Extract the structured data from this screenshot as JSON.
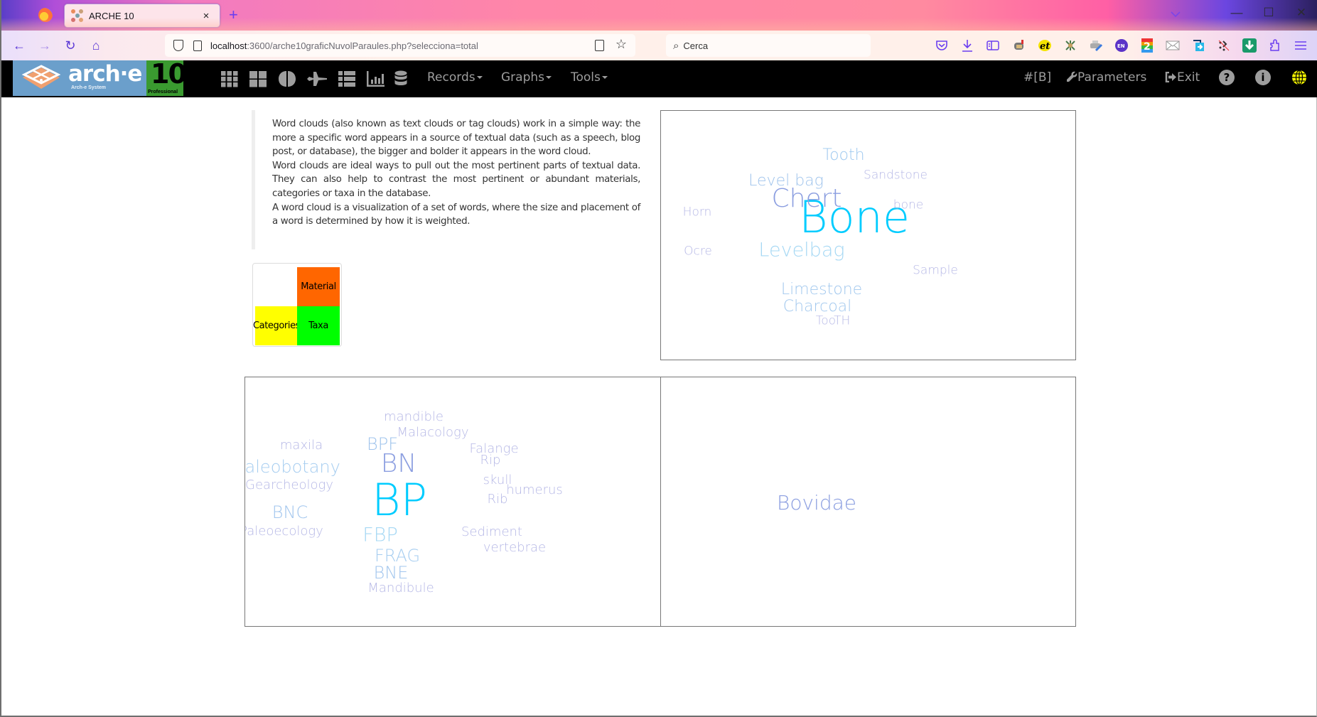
{
  "browser": {
    "tab_title": "ARCHE 10",
    "tab_close": "×",
    "new_tab": "+",
    "url_host": "localhost",
    "url_rest": ":3600/arche10graficNuvolParaules.php?selecciona=total",
    "search_placeholder": "Cerca",
    "list_tabs_icon": "chevron-down-icon",
    "window_controls": {
      "minimize": "—",
      "maximize": "☐",
      "close": "✕"
    },
    "nav": {
      "back": "←",
      "forward": "→",
      "reload": "↻",
      "home": "⌂"
    },
    "extensions": [
      "pocket-icon",
      "download-icon",
      "sidebar-icon",
      "mailbox-icon",
      "et-icon",
      "figure-icon",
      "printer-icon",
      "en-translate-icon",
      "two-icon",
      "mail-icon",
      "share-icon",
      "cursor-off-icon",
      "green-download-icon",
      "extensions-puzzle-icon",
      "hamburger-menu-icon"
    ]
  },
  "app": {
    "logo": {
      "name": "arch·e",
      "subtitle": "Arch-e System",
      "version": "10",
      "edition": "Professional"
    },
    "toolbar_icons": [
      "grid-9-icon",
      "grid-4-icon",
      "brain-icon",
      "plane-icon",
      "list-icon",
      "bar-chart-icon",
      "database-icon"
    ],
    "menus": [
      {
        "label": "Records"
      },
      {
        "label": "Graphs"
      },
      {
        "label": "Tools"
      }
    ],
    "right": {
      "hash_label": "#[B]",
      "parameters_label": "Parameters",
      "exit_label": "Exit",
      "help_glyph": "?",
      "info_glyph": "i"
    }
  },
  "intro": {
    "paragraphs": [
      "Word clouds (also known as text clouds or tag clouds) work in a simple way: the more a specific word appears in a source of textual data (such as a speech, blog post, or database), the bigger and bolder it appears in the word cloud.",
      "Word clouds are ideal ways to pull out the most pertinent parts of textual data. They can also help to contrast the most pertinent or abundant materials, categories or taxa in the database.",
      "A word cloud is a visualization of a set of words, where the size and placement of a word is determined by how it is weighted."
    ]
  },
  "legend": {
    "material": {
      "label": "Material",
      "color": "#ff6600"
    },
    "categories": {
      "label": "Categories",
      "color": "#ffff00"
    },
    "taxa": {
      "label": "Taxa",
      "color": "#00ff00"
    }
  },
  "clouds": {
    "material": [
      {
        "text": "Bone",
        "weight": 100,
        "color": "#00ccff"
      },
      {
        "text": "Chert",
        "weight": 50,
        "color": "#8b9ee0"
      },
      {
        "text": "Levelbag",
        "weight": 33,
        "color": "#a6d8f4"
      },
      {
        "text": "Level bag",
        "weight": 24,
        "color": "#a0c4ec"
      },
      {
        "text": "Tooth",
        "weight": 24,
        "color": "#9ec8ef"
      },
      {
        "text": "Limestone",
        "weight": 24,
        "color": "#a2c8ee"
      },
      {
        "text": "Charcoal",
        "weight": 24,
        "color": "#a2c8ee"
      },
      {
        "text": "Sandstone",
        "weight": 14,
        "color": "#b6b8e6"
      },
      {
        "text": "bone",
        "weight": 14,
        "color": "#b6b8e6"
      },
      {
        "text": "Horn",
        "weight": 14,
        "color": "#b6b8e6"
      },
      {
        "text": "Ocre",
        "weight": 14,
        "color": "#b6b8e6"
      },
      {
        "text": "Sample",
        "weight": 14,
        "color": "#b6b8e6"
      },
      {
        "text": "TooTH",
        "weight": 13,
        "color": "#b6b8e6"
      }
    ],
    "categories": [
      {
        "text": "BP",
        "weight": 100,
        "color": "#00ccff"
      },
      {
        "text": "BN",
        "weight": 50,
        "color": "#8b9ee0"
      },
      {
        "text": "FBP",
        "weight": 33,
        "color": "#a6d8f4"
      },
      {
        "text": "BPF",
        "weight": 26,
        "color": "#a0c4ec"
      },
      {
        "text": "Paleobotany",
        "weight": 26,
        "color": "#a6cdf0"
      },
      {
        "text": "BNC",
        "weight": 26,
        "color": "#a2c6ee"
      },
      {
        "text": "FRAG",
        "weight": 26,
        "color": "#a6cdf0"
      },
      {
        "text": "BNE",
        "weight": 26,
        "color": "#a2c6ee"
      },
      {
        "text": "mandible",
        "weight": 15,
        "color": "#b6b8e6"
      },
      {
        "text": "Malacology",
        "weight": 15,
        "color": "#b6b8e6"
      },
      {
        "text": "maxila",
        "weight": 15,
        "color": "#b6b8e6"
      },
      {
        "text": "Falange",
        "weight": 15,
        "color": "#b6b8e6"
      },
      {
        "text": "Rip",
        "weight": 15,
        "color": "#b6b8e6"
      },
      {
        "text": "Gearcheology",
        "weight": 15,
        "color": "#b6b8e6"
      },
      {
        "text": "skull",
        "weight": 15,
        "color": "#b6b8e6"
      },
      {
        "text": "humerus",
        "weight": 15,
        "color": "#b6b8e6"
      },
      {
        "text": "Rib",
        "weight": 15,
        "color": "#b6b8e6"
      },
      {
        "text": "Paleoecology",
        "weight": 15,
        "color": "#b6b8e6"
      },
      {
        "text": "Sediment",
        "weight": 15,
        "color": "#b6b8e6"
      },
      {
        "text": "vertebrae",
        "weight": 15,
        "color": "#b6b8e6"
      },
      {
        "text": "Mandibule",
        "weight": 15,
        "color": "#b6b8e6"
      }
    ],
    "taxa": [
      {
        "text": "Bovidae",
        "weight": 100,
        "color": "#8b9ee0"
      }
    ]
  }
}
